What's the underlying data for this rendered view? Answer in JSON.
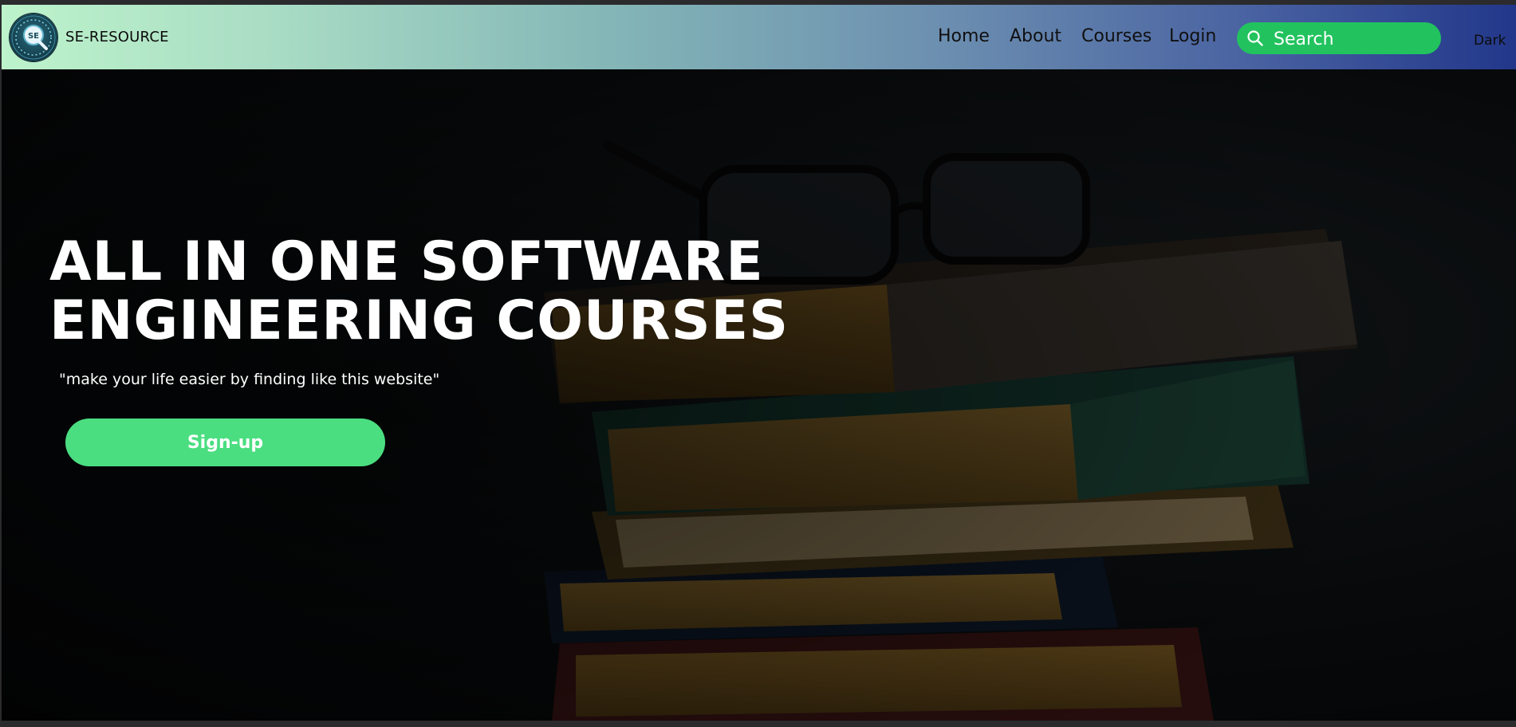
{
  "navbar": {
    "brand": "SE-RESOURCE",
    "logo_icon": "se-magnifier-gear-logo",
    "links": [
      "Home",
      "About",
      "Courses",
      "Login"
    ],
    "search": {
      "placeholder": "Search",
      "icon": "search-icon"
    },
    "theme_toggle": "Dark"
  },
  "hero": {
    "title_line1": "ALL IN ONE SOFTWARE",
    "title_line2": "ENGINEERING COURSES",
    "tagline": "\"make your life easier by finding like this website\"",
    "cta_label": "Sign-up",
    "background_image": "stack-of-books-with-glasses"
  },
  "colors": {
    "nav_gradient_start": "#bdf3cb",
    "nav_gradient_end": "#22378a",
    "search_bg": "#22c35e",
    "cta_bg": "#4ade80",
    "hero_text": "#ffffff"
  }
}
